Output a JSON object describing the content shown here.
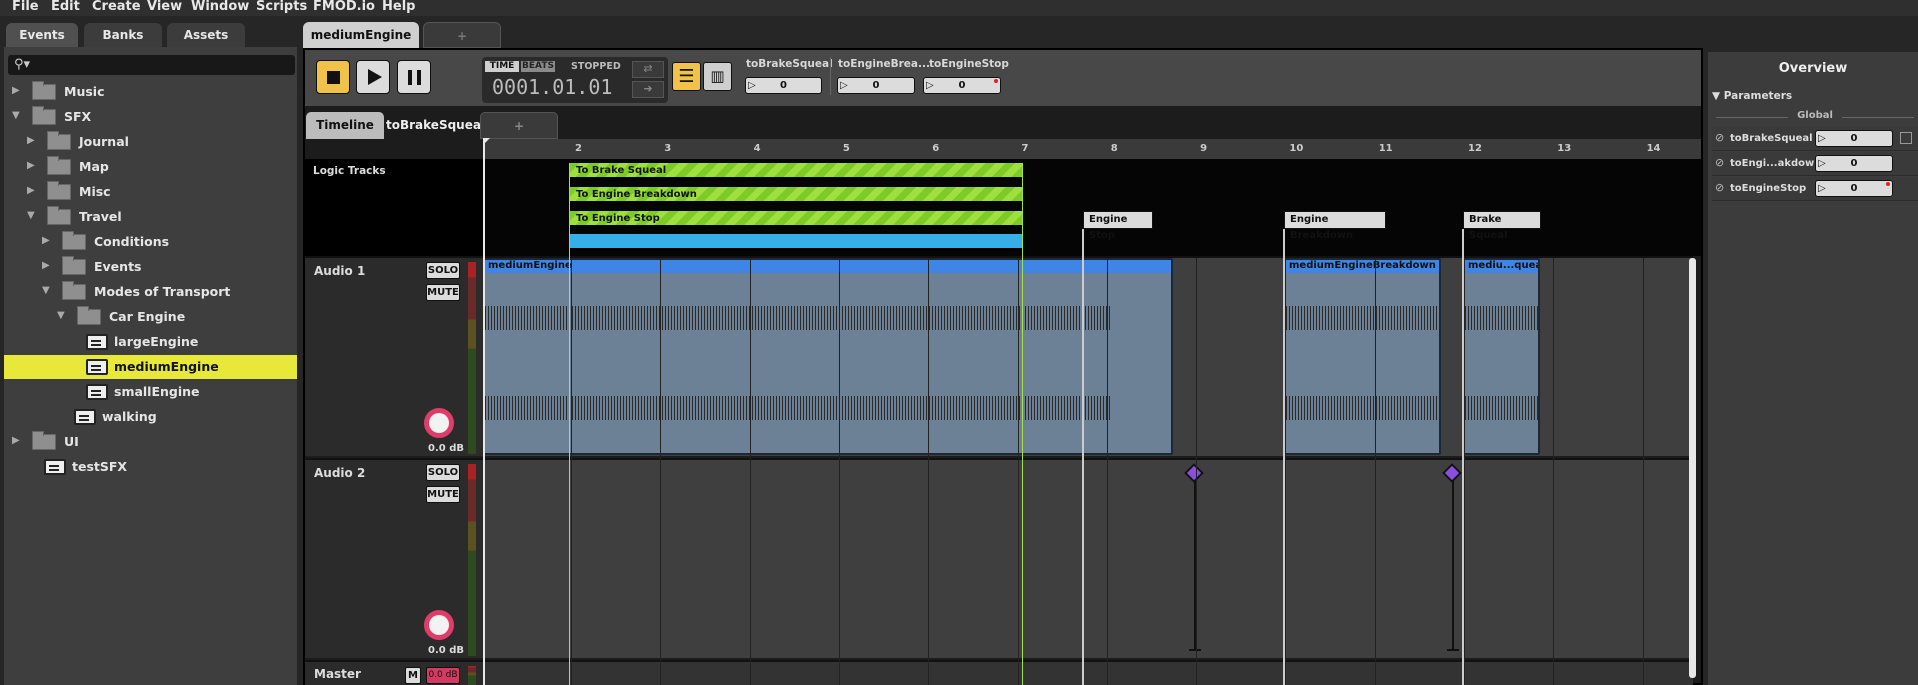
{
  "menu": [
    "File",
    "Edit",
    "Create",
    "View",
    "Window",
    "Scripts",
    "FMOD.io",
    "Help"
  ],
  "browser_tabs": [
    "Events",
    "Banks",
    "Assets"
  ],
  "tree": [
    {
      "label": "Music",
      "kind": "folder",
      "arrow": "▶"
    },
    {
      "label": "SFX",
      "kind": "folder",
      "arrow": "▼"
    },
    {
      "label": "Journal",
      "kind": "folder",
      "arrow": "▶"
    },
    {
      "label": "Map",
      "kind": "folder",
      "arrow": "▶"
    },
    {
      "label": "Misc",
      "kind": "folder",
      "arrow": "▶"
    },
    {
      "label": "Travel",
      "kind": "folder",
      "arrow": "▼"
    },
    {
      "label": "Conditions",
      "kind": "folder",
      "arrow": "▶"
    },
    {
      "label": "Events",
      "kind": "folder",
      "arrow": "▶"
    },
    {
      "label": "Modes of Transport",
      "kind": "folder",
      "arrow": "▼"
    },
    {
      "label": "Car Engine",
      "kind": "folder",
      "arrow": "▼"
    },
    {
      "label": "largeEngine",
      "kind": "event",
      "arrow": ""
    },
    {
      "label": "mediumEngine",
      "kind": "event",
      "arrow": ""
    },
    {
      "label": "smallEngine",
      "kind": "event",
      "arrow": ""
    },
    {
      "label": "walking",
      "kind": "event",
      "arrow": ""
    },
    {
      "label": "UI",
      "kind": "folder",
      "arrow": "▶"
    },
    {
      "label": "testSFX",
      "kind": "event",
      "arrow": ""
    }
  ],
  "editor_tabs": {
    "active": "mediumEngine",
    "add": "+"
  },
  "transport": {
    "time_label": "TIME",
    "beats_label": "BEATS",
    "state": "STOPPED",
    "position": "0001.01.01"
  },
  "params": [
    {
      "name": "toBrakeSqueal",
      "value": "0"
    },
    {
      "name": "toEngineBrea...",
      "value": "0"
    },
    {
      "name": "toEngineStop",
      "value": "0"
    }
  ],
  "sheet_tabs": [
    "Timeline",
    "toBrakeSqueal",
    "+"
  ],
  "ruler": [
    "2",
    "3",
    "4",
    "5",
    "6",
    "7",
    "8",
    "9",
    "10",
    "11",
    "12",
    "13",
    "14"
  ],
  "logic": {
    "header": "Logic Tracks",
    "regions": [
      "To Brake Squeal",
      "To Engine Breakdown",
      "To Engine Stop"
    ],
    "markers": [
      "Engine Stop",
      "Engine Breakdown",
      "Brake Squeal"
    ]
  },
  "tracks": [
    {
      "name": "Audio 1",
      "solo": "SOLO",
      "mute": "MUTE",
      "db": "0.0 dB"
    },
    {
      "name": "Audio 2",
      "solo": "SOLO",
      "mute": "MUTE",
      "db": "0.0 dB"
    }
  ],
  "clips": [
    "mediumEngine",
    "mediumEngineBreakdown",
    "mediu...queal"
  ],
  "master": {
    "name": "Master",
    "m": "M",
    "db": "0.0 dB"
  },
  "overview": {
    "title": "Overview",
    "section": "Parameters",
    "group": "Global",
    "params": [
      {
        "name": "toBrakeSqueal",
        "value": "0"
      },
      {
        "name": "toEngi...akdown",
        "value": "0"
      },
      {
        "name": "toEngineStop",
        "value": "0"
      }
    ]
  },
  "colors": {
    "accent_yellow": "#e8e83a",
    "logic_green": "#8fd434",
    "clip_blue": "#3f85e6",
    "knob_pink": "#e03c6a",
    "marker_purple": "#8a4fe0"
  }
}
